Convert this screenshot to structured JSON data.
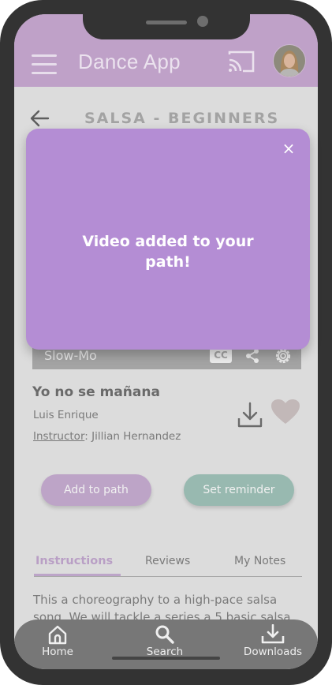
{
  "header": {
    "title": "Dance App"
  },
  "page": {
    "title": "SALSA - BEGINNERS"
  },
  "video": {
    "speed_label": "Slow-Mo",
    "cc_label": "CC"
  },
  "song": {
    "title": "Yo no se mañana",
    "artist": "Luis Enrique",
    "instructor_label": "Instructor",
    "instructor_name": ": Jillian Hernandez"
  },
  "actions": {
    "add_to_path": "Add to path",
    "set_reminder": "Set reminder"
  },
  "tabs": [
    {
      "label": "Instructions",
      "active": true
    },
    {
      "label": "Reviews",
      "active": false
    },
    {
      "label": "My Notes",
      "active": false
    }
  ],
  "description": "This a choreography to a high-pace salsa song. We will tackle a series a 5 basic salsa",
  "nav": [
    {
      "label": "Home",
      "icon": "home-icon"
    },
    {
      "label": "Search",
      "icon": "search-icon"
    },
    {
      "label": "Downloads",
      "icon": "download-icon"
    }
  ],
  "modal": {
    "message": "Video added to your path!",
    "close_glyph": "×"
  },
  "colors": {
    "appbar": "#bfa1c8",
    "modal": "#b48dd4",
    "add_button": "#bda4c7",
    "reminder_button": "#98b9b0",
    "nav_bar": "#777777"
  }
}
